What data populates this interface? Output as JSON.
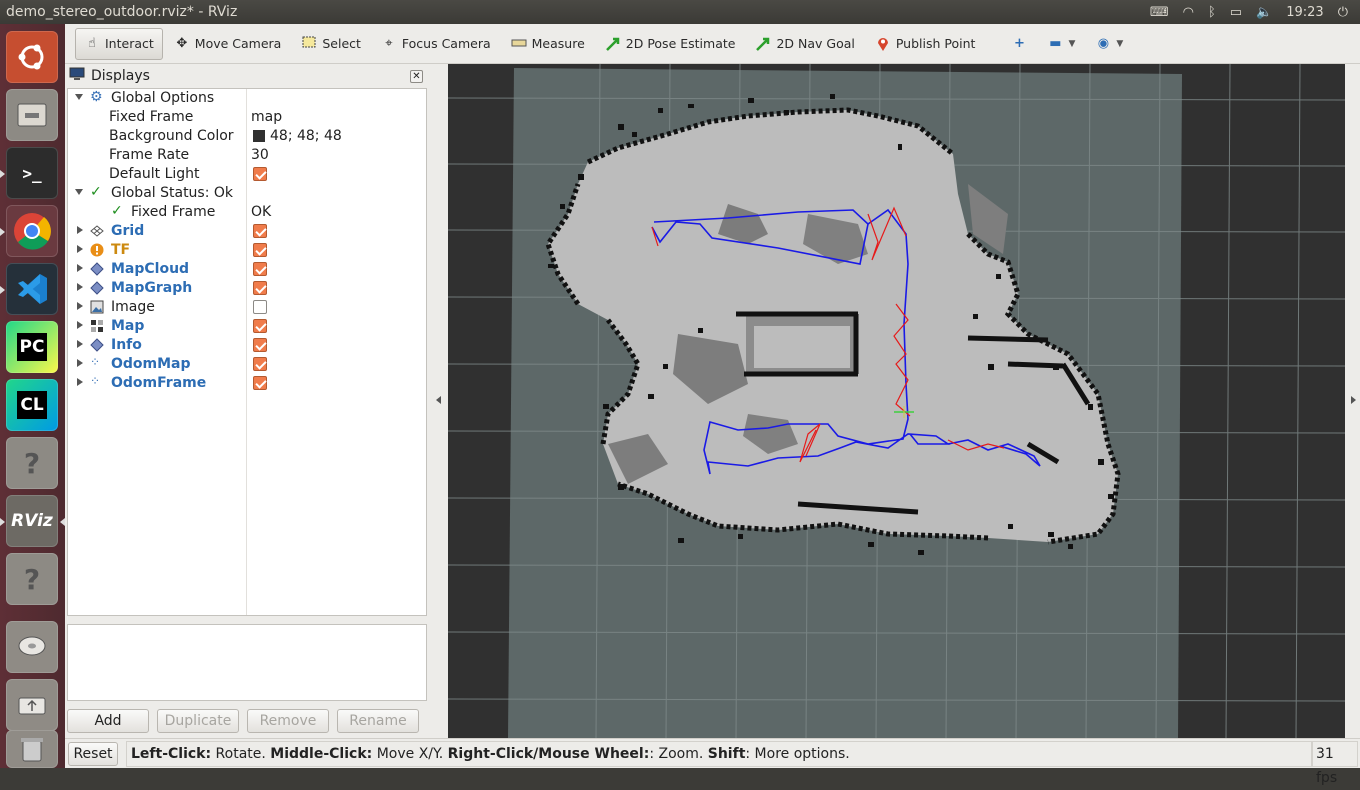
{
  "window": {
    "title": "demo_stereo_outdoor.rviz* - RViz"
  },
  "tray": {
    "time": "19:23",
    "keyboard_icon": "keyboard-icon",
    "wifi_icon": "wifi-icon",
    "bluetooth_icon": "bluetooth-icon",
    "battery_icon": "battery-icon",
    "volume_icon": "volume-icon",
    "power_icon": "power-icon"
  },
  "launcher": [
    {
      "name": "ubuntu-dash",
      "label": ""
    },
    {
      "name": "files",
      "label": ""
    },
    {
      "name": "terminal",
      "label": ">_"
    },
    {
      "name": "chrome",
      "label": ""
    },
    {
      "name": "vscode",
      "label": ""
    },
    {
      "name": "pycharm",
      "label": "PC"
    },
    {
      "name": "clion",
      "label": "CL"
    },
    {
      "name": "unknown-app",
      "label": "?"
    },
    {
      "name": "rviz",
      "label": "RViz"
    },
    {
      "name": "unknown-app-2",
      "label": "?"
    },
    {
      "name": "disk",
      "label": ""
    },
    {
      "name": "usb-drive",
      "label": ""
    },
    {
      "name": "trash",
      "label": ""
    }
  ],
  "toolbar": {
    "interact": "Interact",
    "move_camera": "Move Camera",
    "select": "Select",
    "focus_camera": "Focus Camera",
    "measure": "Measure",
    "pose_estimate": "2D Pose Estimate",
    "nav_goal": "2D Nav Goal",
    "publish_point": "Publish Point"
  },
  "displays": {
    "title": "Displays",
    "global_options": "Global Options",
    "fixed_frame_label": "Fixed Frame",
    "fixed_frame_value": "map",
    "bg_color_label": "Background Color",
    "bg_color_value": "48; 48; 48",
    "frame_rate_label": "Frame Rate",
    "frame_rate_value": "30",
    "default_light_label": "Default Light",
    "global_status": "Global Status: Ok",
    "status_fixed_frame": "Fixed Frame",
    "status_fixed_frame_value": "OK",
    "items": [
      {
        "label": "Grid",
        "checked": true
      },
      {
        "label": "TF",
        "checked": true
      },
      {
        "label": "MapCloud",
        "checked": true
      },
      {
        "label": "MapGraph",
        "checked": true
      },
      {
        "label": "Image",
        "checked": false
      },
      {
        "label": "Map",
        "checked": true
      },
      {
        "label": "Info",
        "checked": true
      },
      {
        "label": "OdomMap",
        "checked": true
      },
      {
        "label": "OdomFrame",
        "checked": true
      }
    ]
  },
  "buttons": {
    "add": "Add",
    "duplicate": "Duplicate",
    "remove": "Remove",
    "rename": "Rename"
  },
  "status": {
    "reset": "Reset",
    "hint_left_key": "Left-Click:",
    "hint_left": " Rotate. ",
    "hint_middle_key": "Middle-Click:",
    "hint_middle": " Move X/Y. ",
    "hint_right_key": "Right-Click/Mouse Wheel:",
    "hint_right": ": Zoom. ",
    "hint_shift_key": "Shift",
    "hint_shift": ": More options.",
    "fps": "31 fps"
  },
  "colors": {
    "viewport_bg": "#303030",
    "ground": "#5f6b6b",
    "free": "#bdbdbd",
    "occupied": "#111111",
    "path_blue": "#1a1ae6",
    "path_red": "#e61a1a",
    "checkbox": "#f07c4b"
  }
}
